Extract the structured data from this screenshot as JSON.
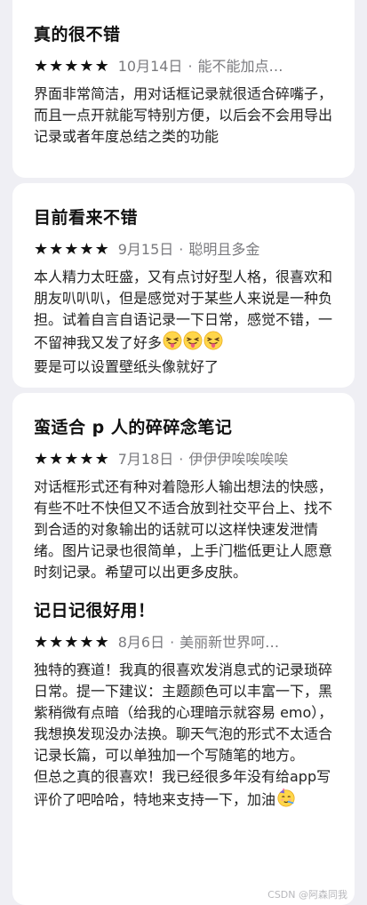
{
  "reviews": [
    {
      "title": "真的很不错",
      "date": "10月14日",
      "author": "能不能加点…",
      "body": [
        "界面非常简洁，用对话框记录就很适合碎嘴子，而且一点开就能写特别方便，以后会不会用导出记录或者年度总结之类的功能"
      ]
    },
    {
      "title": "目前看来不错",
      "date": "9月15日",
      "author": "聪明且多金",
      "body": [
        "本人精力太旺盛，又有点讨好型人格，很喜欢和朋友叭叭叭，但是感觉对于某些人来说是一种负担。试着自言自语记录一下日常，感觉不错，一不留神我又发了好多",
        "要是可以设置壁纸头像就好了"
      ]
    },
    {
      "title": "蛮适合 p 人的碎碎念笔记",
      "date": "7月18日",
      "author": "伊伊伊唉唉唉唉",
      "body": [
        "对话框形式还有种对着隐形人输出想法的快感，有些不吐不快但又不适合放到社交平台上、找不到合适的对象输出的话就可以这样快速发泄情绪。图片记录也很简单，上手门槛低更让人愿意时刻记录。希望可以出更多皮肤。"
      ]
    },
    {
      "title": "记日记很好用！",
      "date": "8月6日",
      "author": "美丽新世界呵…",
      "body": [
        "独特的赛道！我真的很喜欢发消息式的记录琐碎日常。提一下建议：主题颜色可以丰富一下，黑紫稍微有点暗（给我的心理暗示就容易 emo），我想换发现没办法换。聊天气泡的形式不太适合记录长篇，可以单独加一个写随笔的地方。",
        "但总之真的很喜欢！我已经很多年没有给app写评价了吧哈哈，特地来支持一下，加油"
      ]
    }
  ],
  "rating_glyph": "★",
  "separator": "·",
  "icons": {
    "tongue": "tongue-out-emoji",
    "party": "party-face-emoji"
  },
  "watermark": "CSDN @阿森同我",
  "colors": {
    "background": "#efeff4",
    "card": "#ffffff",
    "meta": "#7a7a7e",
    "star": "#111111"
  }
}
